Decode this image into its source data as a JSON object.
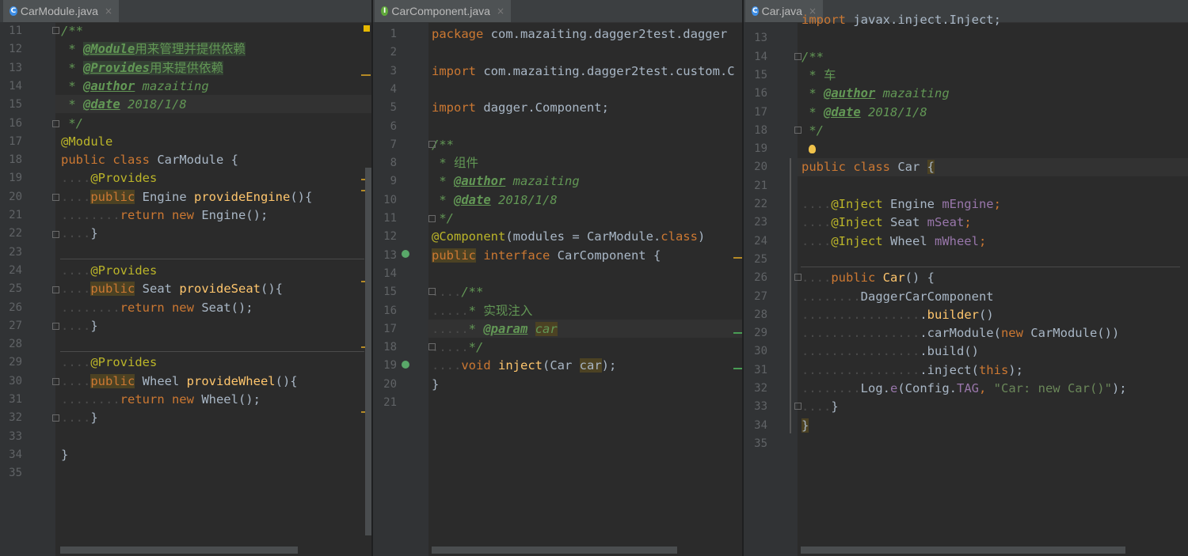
{
  "panes": [
    {
      "tab": {
        "file": "CarModule.java",
        "icon": "C",
        "icon_color": "#3d8ee6",
        "close": "×"
      },
      "lines": [
        {
          "n": "11",
          "s": [
            [
              "cm",
              "/**"
            ]
          ]
        },
        {
          "n": "12",
          "s": [
            [
              "cm",
              " * "
            ],
            [
              "ct hl",
              "@Module"
            ],
            [
              "cm hl cx",
              "用来管理并提供依赖"
            ]
          ]
        },
        {
          "n": "13",
          "s": [
            [
              "cm",
              " * "
            ],
            [
              "ct hl",
              "@Provides"
            ],
            [
              "cm hl cx",
              "用来提供依赖"
            ]
          ]
        },
        {
          "n": "14",
          "s": [
            [
              "cm",
              " * "
            ],
            [
              "ct",
              "@author"
            ],
            [
              "cm",
              " mazaiting"
            ]
          ]
        },
        {
          "n": "15",
          "s": [
            [
              "cm",
              " * "
            ],
            [
              "ct",
              "@date"
            ],
            [
              "cm",
              " 2018/1/8"
            ]
          ]
        },
        {
          "n": "16",
          "s": [
            [
              "cm",
              " */"
            ]
          ]
        },
        {
          "n": "17",
          "s": [
            [
              "an",
              "@Module"
            ]
          ]
        },
        {
          "n": "18",
          "s": [
            [
              "kw",
              "public class "
            ],
            [
              "",
              "CarModule {"
            ]
          ]
        },
        {
          "n": "19",
          "s": [
            [
              "ws",
              "...."
            ],
            [
              "an",
              "@Provides"
            ]
          ]
        },
        {
          "n": "20",
          "s": [
            [
              "ws",
              "...."
            ],
            [
              "kw mk",
              "public"
            ],
            [
              "",
              " Engine "
            ],
            [
              "fn",
              "provideEngine"
            ],
            [
              "",
              "(){"
            ]
          ]
        },
        {
          "n": "21",
          "s": [
            [
              "ws",
              "........"
            ],
            [
              "kw",
              "return new "
            ],
            [
              "",
              "Engine();"
            ]
          ]
        },
        {
          "n": "22",
          "s": [
            [
              "ws",
              "...."
            ],
            [
              "",
              "}"
            ]
          ]
        },
        {
          "n": "23",
          "s": []
        },
        {
          "n": "24",
          "s": [
            [
              "ws",
              "...."
            ],
            [
              "an",
              "@Provides"
            ]
          ]
        },
        {
          "n": "25",
          "s": [
            [
              "ws",
              "...."
            ],
            [
              "kw mk",
              "public"
            ],
            [
              "",
              " Seat "
            ],
            [
              "fn",
              "provideSeat"
            ],
            [
              "",
              "(){"
            ]
          ]
        },
        {
          "n": "26",
          "s": [
            [
              "ws",
              "........"
            ],
            [
              "kw",
              "return new "
            ],
            [
              "",
              "Seat();"
            ]
          ]
        },
        {
          "n": "27",
          "s": [
            [
              "ws",
              "...."
            ],
            [
              "",
              "}"
            ]
          ]
        },
        {
          "n": "28",
          "s": []
        },
        {
          "n": "29",
          "s": [
            [
              "ws",
              "...."
            ],
            [
              "an",
              "@Provides"
            ]
          ]
        },
        {
          "n": "30",
          "s": [
            [
              "ws",
              "...."
            ],
            [
              "kw mk",
              "public"
            ],
            [
              "",
              " Wheel "
            ],
            [
              "fn",
              "provideWheel"
            ],
            [
              "",
              "(){"
            ]
          ]
        },
        {
          "n": "31",
          "s": [
            [
              "ws",
              "........"
            ],
            [
              "kw",
              "return new "
            ],
            [
              "",
              "Wheel();"
            ]
          ]
        },
        {
          "n": "32",
          "s": [
            [
              "ws",
              "...."
            ],
            [
              "",
              "}"
            ]
          ]
        },
        {
          "n": "33",
          "s": []
        },
        {
          "n": "34",
          "s": [
            [
              "",
              "}"
            ]
          ]
        },
        {
          "n": "35",
          "s": []
        }
      ]
    },
    {
      "tab": {
        "file": "CarComponent.java",
        "icon": "I",
        "icon_color": "#5fa83a",
        "close": "×"
      },
      "lines": [
        {
          "n": "1",
          "s": [
            [
              "kw",
              "package "
            ],
            [
              "",
              "com.mazaiting.dagger2test.dagger"
            ]
          ]
        },
        {
          "n": "2",
          "s": []
        },
        {
          "n": "3",
          "s": [
            [
              "kw",
              "import "
            ],
            [
              "",
              "com.mazaiting.dagger2test.custom.C"
            ]
          ]
        },
        {
          "n": "4",
          "s": []
        },
        {
          "n": "5",
          "s": [
            [
              "kw",
              "import "
            ],
            [
              "",
              "dagger.Component;"
            ]
          ]
        },
        {
          "n": "6",
          "s": []
        },
        {
          "n": "7",
          "s": [
            [
              "cm",
              "/**"
            ]
          ]
        },
        {
          "n": "8",
          "s": [
            [
              "cm",
              " * "
            ],
            [
              "cm cx",
              "组件"
            ]
          ]
        },
        {
          "n": "9",
          "s": [
            [
              "cm",
              " * "
            ],
            [
              "ct",
              "@author"
            ],
            [
              "cm",
              " mazaiting"
            ]
          ]
        },
        {
          "n": "10",
          "s": [
            [
              "cm",
              " * "
            ],
            [
              "ct",
              "@date"
            ],
            [
              "cm",
              " 2018/1/8"
            ]
          ]
        },
        {
          "n": "11",
          "s": [
            [
              "cm",
              " */"
            ]
          ]
        },
        {
          "n": "12",
          "s": [
            [
              "an",
              "@Component"
            ],
            [
              "",
              "(modules = CarModule."
            ],
            [
              "kw",
              "class"
            ],
            [
              "",
              ")"
            ]
          ]
        },
        {
          "n": "13",
          "s": [
            [
              "kw mk",
              "public"
            ],
            [
              "kw",
              " interface "
            ],
            [
              "",
              "CarComponent {"
            ]
          ]
        },
        {
          "n": "14",
          "s": []
        },
        {
          "n": "15",
          "s": [
            [
              "ws",
              "...."
            ],
            [
              "cm",
              "/**"
            ]
          ]
        },
        {
          "n": "16",
          "s": [
            [
              "ws",
              "....."
            ],
            [
              "cm",
              "* "
            ],
            [
              "cm cx",
              "实现注入"
            ]
          ]
        },
        {
          "n": "17",
          "s": [
            [
              "ws",
              "....."
            ],
            [
              "cm",
              "* "
            ],
            [
              "ct",
              "@param"
            ],
            [
              "cm",
              " "
            ],
            [
              "cm mk",
              "car"
            ]
          ]
        },
        {
          "n": "18",
          "s": [
            [
              "ws",
              "....."
            ],
            [
              "cm",
              "*/"
            ]
          ]
        },
        {
          "n": "19",
          "s": [
            [
              "ws",
              "...."
            ],
            [
              "kw",
              "void "
            ],
            [
              "fn",
              "inject"
            ],
            [
              "",
              "(Car "
            ],
            [
              "mk",
              "car"
            ],
            [
              "",
              ");"
            ]
          ]
        },
        {
          "n": "20",
          "s": [
            [
              "",
              "}"
            ]
          ]
        },
        {
          "n": "21",
          "s": []
        }
      ]
    },
    {
      "tab": {
        "file": "Car.java",
        "icon": "C",
        "icon_color": "#3d8ee6",
        "close": "×"
      },
      "lines": [
        {
          "n": "",
          "s": [
            [
              "kw",
              "import "
            ],
            [
              "",
              "javax.inject.Inject;"
            ]
          ]
        },
        {
          "n": "13",
          "s": []
        },
        {
          "n": "14",
          "s": [
            [
              "cm",
              "/**"
            ]
          ]
        },
        {
          "n": "15",
          "s": [
            [
              "cm",
              " * "
            ],
            [
              "cm cx",
              "车"
            ]
          ]
        },
        {
          "n": "16",
          "s": [
            [
              "cm",
              " * "
            ],
            [
              "ct",
              "@author"
            ],
            [
              "cm",
              " mazaiting"
            ]
          ]
        },
        {
          "n": "17",
          "s": [
            [
              "cm",
              " * "
            ],
            [
              "ct",
              "@date"
            ],
            [
              "cm",
              " 2018/1/8"
            ]
          ]
        },
        {
          "n": "18",
          "s": [
            [
              "cm",
              " */"
            ]
          ]
        },
        {
          "n": "19",
          "s": []
        },
        {
          "n": "20",
          "s": [
            [
              "kw",
              "public class "
            ],
            [
              "",
              "Car "
            ],
            [
              "mk",
              "{"
            ]
          ]
        },
        {
          "n": "21",
          "s": []
        },
        {
          "n": "22",
          "s": [
            [
              "ws",
              "...."
            ],
            [
              "an",
              "@Inject"
            ],
            [
              "",
              " Engine "
            ],
            [
              "fd",
              "mEngine"
            ],
            [
              "kw",
              ";"
            ]
          ]
        },
        {
          "n": "23",
          "s": [
            [
              "ws",
              "...."
            ],
            [
              "an",
              "@Inject"
            ],
            [
              "",
              " Seat "
            ],
            [
              "fd",
              "mSeat"
            ],
            [
              "kw",
              ";"
            ]
          ]
        },
        {
          "n": "24",
          "s": [
            [
              "ws",
              "...."
            ],
            [
              "an",
              "@Inject"
            ],
            [
              "",
              " Wheel "
            ],
            [
              "fd",
              "mWheel"
            ],
            [
              "kw",
              ";"
            ]
          ]
        },
        {
          "n": "25",
          "s": []
        },
        {
          "n": "26",
          "s": [
            [
              "ws",
              "...."
            ],
            [
              "kw",
              "public "
            ],
            [
              "fn",
              "Car"
            ],
            [
              "",
              "() {"
            ]
          ]
        },
        {
          "n": "27",
          "s": [
            [
              "ws",
              "........"
            ],
            [
              "",
              "DaggerCarComponent"
            ]
          ]
        },
        {
          "n": "28",
          "s": [
            [
              "ws",
              "................"
            ],
            [
              "",
              "."
            ],
            [
              "fn",
              "builder"
            ],
            [
              "",
              "()"
            ]
          ]
        },
        {
          "n": "29",
          "s": [
            [
              "ws",
              "................"
            ],
            [
              "",
              ".carModule("
            ],
            [
              "kw",
              "new "
            ],
            [
              "",
              "CarModule())"
            ]
          ]
        },
        {
          "n": "30",
          "s": [
            [
              "ws",
              "................"
            ],
            [
              "",
              ".build()"
            ]
          ]
        },
        {
          "n": "31",
          "s": [
            [
              "ws",
              "................"
            ],
            [
              "",
              ".inject("
            ],
            [
              "kw",
              "this"
            ],
            [
              "",
              ");"
            ]
          ]
        },
        {
          "n": "32",
          "s": [
            [
              "ws",
              "........"
            ],
            [
              "",
              "Log."
            ],
            [
              "fd",
              "e"
            ],
            [
              "",
              "(Config."
            ],
            [
              "fd",
              "TAG"
            ],
            [
              "kw",
              ", "
            ],
            [
              "st",
              "\"Car: new Car()\""
            ],
            [
              "",
              ");"
            ]
          ]
        },
        {
          "n": "33",
          "s": [
            [
              "ws",
              "...."
            ],
            [
              "",
              "}"
            ]
          ]
        },
        {
          "n": "34",
          "s": [
            [
              "mk",
              "}"
            ]
          ]
        },
        {
          "n": "35",
          "s": []
        }
      ]
    }
  ]
}
